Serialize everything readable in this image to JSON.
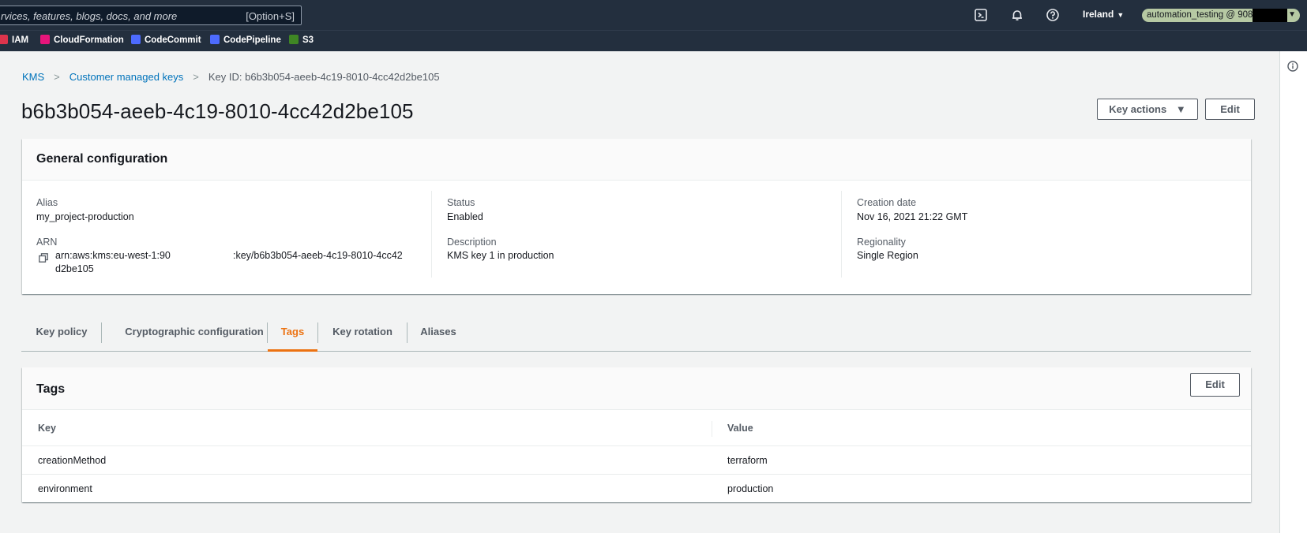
{
  "topnav": {
    "search_placeholder": "rvices, features, blogs, docs, and more",
    "search_shortcut": "[Option+S]",
    "region": "Ireland",
    "account": "automation_testing @ 908"
  },
  "favorites": [
    {
      "label": "IAM",
      "color": "#dd344c"
    },
    {
      "label": "CloudFormation",
      "color": "#e7157b"
    },
    {
      "label": "CodeCommit",
      "color": "#4d6bfe"
    },
    {
      "label": "CodePipeline",
      "color": "#4d6bfe"
    },
    {
      "label": "S3",
      "color": "#3f8624"
    }
  ],
  "breadcrumb": {
    "kms": "KMS",
    "cmk": "Customer managed keys",
    "current": "Key ID: b6b3b054-aeeb-4c19-8010-4cc42d2be105"
  },
  "page": {
    "title": "b6b3b054-aeeb-4c19-8010-4cc42d2be105",
    "key_actions": "Key actions",
    "edit": "Edit"
  },
  "general": {
    "heading": "General configuration",
    "alias_label": "Alias",
    "alias_value": "my_project-production",
    "arn_label": "ARN",
    "arn_line1a": "arn:aws:kms:eu-west-1:90",
    "arn_line1b": ":key/b6b3b054-aeeb-4c19-8010-4cc42",
    "arn_line2": "d2be105",
    "status_label": "Status",
    "status_value": "Enabled",
    "description_label": "Description",
    "description_value": "KMS key 1 in production",
    "creation_label": "Creation date",
    "creation_value": "Nov 16, 2021 21:22 GMT",
    "regionality_label": "Regionality",
    "regionality_value": "Single Region"
  },
  "tabs": [
    "Key policy",
    "Cryptographic configuration",
    "Tags",
    "Key rotation",
    "Aliases"
  ],
  "active_tab": "Tags",
  "tags": {
    "heading": "Tags",
    "edit": "Edit",
    "col_key": "Key",
    "col_value": "Value",
    "rows": [
      {
        "key": "creationMethod",
        "value": "terraform"
      },
      {
        "key": "environment",
        "value": "production"
      }
    ]
  },
  "colors": {
    "nav_bg": "#232f3e",
    "link": "#0073bb",
    "accent": "#ec7211"
  }
}
